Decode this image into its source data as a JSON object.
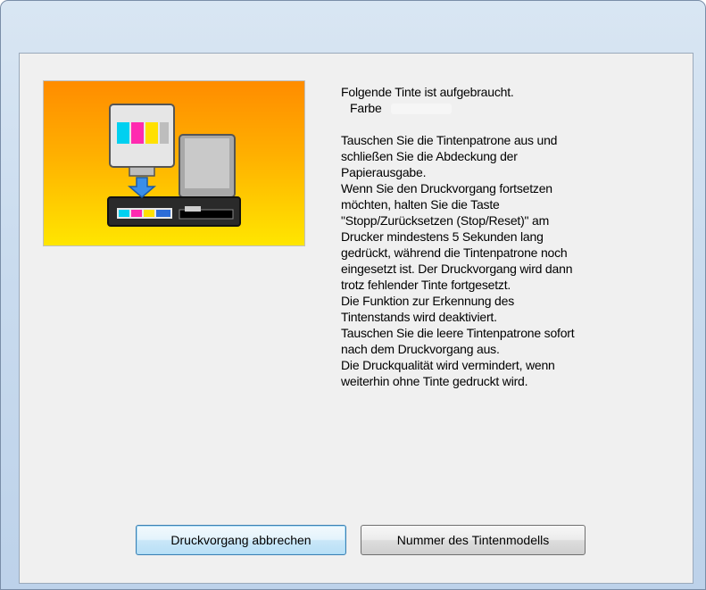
{
  "window": {
    "title": ""
  },
  "dialog": {
    "message": {
      "header": "Folgende Tinte ist aufgebraucht.",
      "color_label": "Farbe",
      "lines": [
        "Tauschen Sie die Tintenpatrone aus und",
        "schließen Sie die Abdeckung der",
        "Papierausgabe.",
        "Wenn Sie den Druckvorgang fortsetzen",
        "möchten, halten Sie die Taste",
        "\"Stopp/Zurücksetzen (Stop/Reset)\" am",
        "Drucker mindestens 5 Sekunden lang",
        "gedrückt, während die Tintenpatrone noch",
        "eingesetzt ist. Der Druckvorgang wird dann",
        "trotz fehlender Tinte fortgesetzt.",
        "Die Funktion zur Erkennung des",
        "Tintenstands wird deaktiviert.",
        "Tauschen Sie die leere Tintenpatrone sofort",
        "nach dem Druckvorgang aus.",
        "Die Druckqualität wird vermindert, wenn",
        "weiterhin ohne Tinte gedruckt wird."
      ]
    },
    "buttons": {
      "cancel_label": "Druckvorgang abbrechen",
      "ink_model_label": "Nummer des Tintenmodells"
    },
    "illustration": {
      "icon": "ink-cartridge-replace-icon",
      "background_top": "#ff8c00",
      "background_bottom": "#ffe600"
    }
  }
}
